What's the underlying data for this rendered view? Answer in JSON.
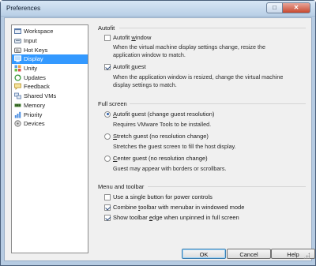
{
  "window": {
    "title": "Preferences",
    "minimize_symbol": "",
    "maximize_symbol": "□",
    "close_symbol": "✕"
  },
  "sidebar": {
    "items": [
      {
        "label": "Workspace",
        "icon": "workspace-icon",
        "selected": false
      },
      {
        "label": "Input",
        "icon": "input-icon",
        "selected": false
      },
      {
        "label": "Hot Keys",
        "icon": "hot-keys-icon",
        "selected": false
      },
      {
        "label": "Display",
        "icon": "display-icon",
        "selected": true
      },
      {
        "label": "Unity",
        "icon": "unity-icon",
        "selected": false
      },
      {
        "label": "Updates",
        "icon": "updates-icon",
        "selected": false
      },
      {
        "label": "Feedback",
        "icon": "feedback-icon",
        "selected": false
      },
      {
        "label": "Shared VMs",
        "icon": "shared-vms-icon",
        "selected": false
      },
      {
        "label": "Memory",
        "icon": "memory-icon",
        "selected": false
      },
      {
        "label": "Priority",
        "icon": "priority-icon",
        "selected": false
      },
      {
        "label": "Devices",
        "icon": "devices-icon",
        "selected": false
      }
    ]
  },
  "autofit": {
    "title": "Autofit",
    "window_label_pre": "Autofit ",
    "window_label_ul": "w",
    "window_label_post": "indow",
    "window_checked": false,
    "window_desc_1": "When the virtual machine display settings change, resize the",
    "window_desc_2": "application window to match.",
    "guest_label_pre": "Autofit ",
    "guest_label_ul": "g",
    "guest_label_post": "uest",
    "guest_checked": true,
    "guest_desc_1": "When the application window is resized, change the virtual machine",
    "guest_desc_2": "display settings to match."
  },
  "full_screen": {
    "title": "Full screen",
    "autofit_ul": "A",
    "autofit_post": "utofit guest (change guest resolution)",
    "autofit_desc": "Requires VMware Tools to be installed.",
    "stretch_ul": "S",
    "stretch_post": "tretch guest (no resolution change)",
    "stretch_desc": "Stretches the guest screen to fill the host display.",
    "center_ul": "C",
    "center_post": "enter guest (no resolution change)",
    "center_desc": "Guest may appear with borders or scrollbars.",
    "selected": "autofit"
  },
  "menu_toolbar": {
    "title": "Menu and toolbar",
    "single_button_label": "Use a single button for power controls",
    "single_button_checked": false,
    "combine_pre": "Combine ",
    "combine_ul": "t",
    "combine_post": "oolbar with menubar in windowed mode",
    "combine_checked": true,
    "show_pre": "Show toolbar ",
    "show_ul": "e",
    "show_post": "dge when unpinned in full screen",
    "show_checked": true
  },
  "buttons": {
    "ok": "OK",
    "cancel": "Cancel",
    "help": "Help"
  }
}
